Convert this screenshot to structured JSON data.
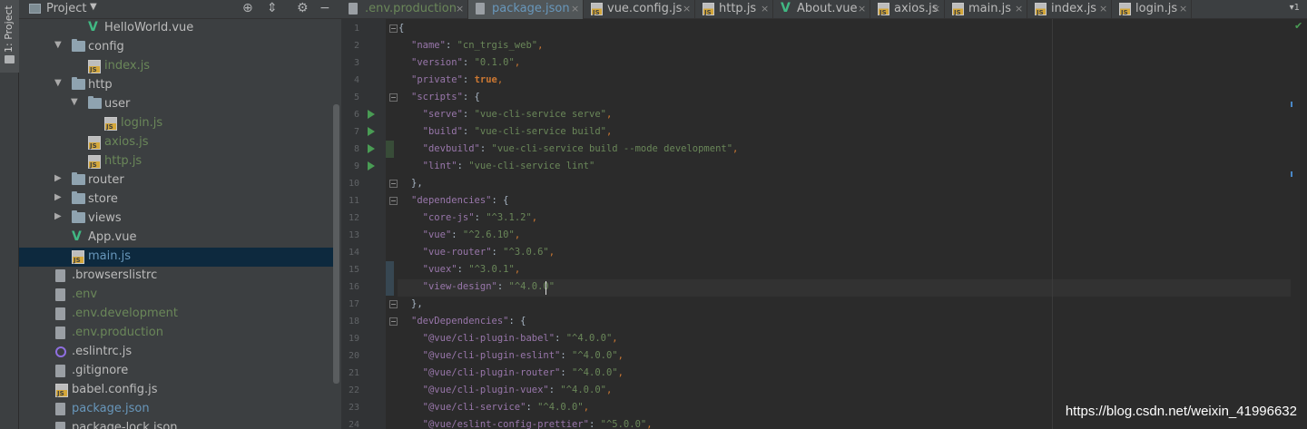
{
  "tool_window": {
    "label": "1: Project"
  },
  "project_panel": {
    "title": "Project",
    "tree": [
      {
        "label": "HelloWorld.vue",
        "icon": "vue-icon",
        "color": "#bbbbbb",
        "depth": 3
      },
      {
        "label": "config",
        "icon": "folder-icon",
        "color": "#bbbbbb",
        "depth": 2,
        "expanded": true
      },
      {
        "label": "index.js",
        "icon": "js-file-icon",
        "color": "#6a8759",
        "depth": 3
      },
      {
        "label": "http",
        "icon": "folder-icon",
        "color": "#bbbbbb",
        "depth": 2,
        "expanded": true
      },
      {
        "label": "user",
        "icon": "folder-icon",
        "color": "#bbbbbb",
        "depth": 3,
        "expanded": true
      },
      {
        "label": "login.js",
        "icon": "js-file-icon",
        "color": "#6a8759",
        "depth": 4
      },
      {
        "label": "axios.js",
        "icon": "js-file-icon",
        "color": "#6a8759",
        "depth": 3
      },
      {
        "label": "http.js",
        "icon": "js-file-icon",
        "color": "#6a8759",
        "depth": 3
      },
      {
        "label": "router",
        "icon": "folder-icon",
        "color": "#bbbbbb",
        "depth": 2,
        "expanded": false
      },
      {
        "label": "store",
        "icon": "folder-icon",
        "color": "#bbbbbb",
        "depth": 2,
        "expanded": false
      },
      {
        "label": "views",
        "icon": "folder-icon",
        "color": "#bbbbbb",
        "depth": 2,
        "expanded": false
      },
      {
        "label": "App.vue",
        "icon": "vue-icon",
        "color": "#bbbbbb",
        "depth": 2
      },
      {
        "label": "main.js",
        "icon": "js-file-icon",
        "color": "#6897bb",
        "depth": 2,
        "selected": true
      },
      {
        "label": ".browserslistrc",
        "icon": "text-file-icon",
        "color": "#bbbbbb",
        "depth": 1
      },
      {
        "label": ".env",
        "icon": "text-file-icon",
        "color": "#6a8759",
        "depth": 1
      },
      {
        "label": ".env.development",
        "icon": "text-file-icon",
        "color": "#6a8759",
        "depth": 1
      },
      {
        "label": ".env.production",
        "icon": "text-file-icon",
        "color": "#6a8759",
        "depth": 1
      },
      {
        "label": ".eslintrc.js",
        "icon": "eslint-icon",
        "color": "#bbbbbb",
        "depth": 1
      },
      {
        "label": ".gitignore",
        "icon": "text-file-icon",
        "color": "#bbbbbb",
        "depth": 1
      },
      {
        "label": "babel.config.js",
        "icon": "js-file-icon",
        "color": "#bbbbbb",
        "depth": 1
      },
      {
        "label": "package.json",
        "icon": "text-file-icon",
        "color": "#6897bb",
        "depth": 1
      },
      {
        "label": "package-lock.json",
        "icon": "text-file-icon",
        "color": "#bbbbbb",
        "depth": 1
      }
    ]
  },
  "tabs": [
    {
      "label": ".env.production",
      "icon": "text-file-icon",
      "color": "#6a8759"
    },
    {
      "label": "package.json",
      "icon": "text-file-icon",
      "color": "#6897bb",
      "active": true
    },
    {
      "label": "vue.config.js",
      "icon": "js-file-icon",
      "color": "#bbbbbb"
    },
    {
      "label": "http.js",
      "icon": "js-file-icon",
      "color": "#bbbbbb"
    },
    {
      "label": "About.vue",
      "icon": "vue-icon",
      "color": "#bbbbbb"
    },
    {
      "label": "axios.js",
      "icon": "js-file-icon",
      "color": "#bbbbbb"
    },
    {
      "label": "main.js",
      "icon": "js-file-icon",
      "color": "#bbbbbb"
    },
    {
      "label": "index.js",
      "icon": "js-file-icon",
      "color": "#bbbbbb"
    },
    {
      "label": "login.js",
      "icon": "js-file-icon",
      "color": "#bbbbbb"
    }
  ],
  "editor": {
    "lines": [
      {
        "n": "1",
        "tokens": [
          [
            "t",
            "{"
          ]
        ]
      },
      {
        "n": "2",
        "tokens": [
          [
            "k",
            "\"name\""
          ],
          [
            "t",
            ": "
          ],
          [
            "s",
            "\"cn_trgis_web\""
          ],
          [
            "p",
            ","
          ]
        ]
      },
      {
        "n": "3",
        "tokens": [
          [
            "k",
            "\"version\""
          ],
          [
            "t",
            ": "
          ],
          [
            "s",
            "\"0.1.0\""
          ],
          [
            "p",
            ","
          ]
        ]
      },
      {
        "n": "4",
        "tokens": [
          [
            "k",
            "\"private\""
          ],
          [
            "t",
            ": "
          ],
          [
            "b",
            "true"
          ],
          [
            "p",
            ","
          ]
        ]
      },
      {
        "n": "5",
        "tokens": [
          [
            "k",
            "\"scripts\""
          ],
          [
            "t",
            ": {"
          ]
        ]
      },
      {
        "n": "6",
        "tokens": [
          [
            "t",
            "  "
          ],
          [
            "k",
            "\"serve\""
          ],
          [
            "t",
            ": "
          ],
          [
            "s",
            "\"vue-cli-service serve\""
          ],
          [
            "p",
            ","
          ]
        ]
      },
      {
        "n": "7",
        "tokens": [
          [
            "t",
            "  "
          ],
          [
            "k",
            "\"build\""
          ],
          [
            "t",
            ": "
          ],
          [
            "s",
            "\"vue-cli-service build\""
          ],
          [
            "p",
            ","
          ]
        ]
      },
      {
        "n": "8",
        "tokens": [
          [
            "t",
            "  "
          ],
          [
            "k",
            "\"devbuild\""
          ],
          [
            "t",
            ": "
          ],
          [
            "s",
            "\"vue-cli-service build --mode development\""
          ],
          [
            "p",
            ","
          ]
        ]
      },
      {
        "n": "9",
        "tokens": [
          [
            "t",
            "  "
          ],
          [
            "k",
            "\"lint\""
          ],
          [
            "t",
            ": "
          ],
          [
            "s",
            "\"vue-cli-service lint\""
          ]
        ]
      },
      {
        "n": "10",
        "tokens": [
          [
            "t",
            "},"
          ]
        ]
      },
      {
        "n": "11",
        "tokens": [
          [
            "k",
            "\"dependencies\""
          ],
          [
            "t",
            ": {"
          ]
        ]
      },
      {
        "n": "12",
        "tokens": [
          [
            "t",
            "  "
          ],
          [
            "k",
            "\"core-js\""
          ],
          [
            "t",
            ": "
          ],
          [
            "s",
            "\"^3.1.2\""
          ],
          [
            "p",
            ","
          ]
        ]
      },
      {
        "n": "13",
        "tokens": [
          [
            "t",
            "  "
          ],
          [
            "k",
            "\"vue\""
          ],
          [
            "t",
            ": "
          ],
          [
            "s",
            "\"^2.6.10\""
          ],
          [
            "p",
            ","
          ]
        ]
      },
      {
        "n": "14",
        "tokens": [
          [
            "t",
            "  "
          ],
          [
            "k",
            "\"vue-router\""
          ],
          [
            "t",
            ": "
          ],
          [
            "s",
            "\"^3.0.6\""
          ],
          [
            "p",
            ","
          ]
        ]
      },
      {
        "n": "15",
        "tokens": [
          [
            "t",
            "  "
          ],
          [
            "k",
            "\"vuex\""
          ],
          [
            "t",
            ": "
          ],
          [
            "s",
            "\"^3.0.1\""
          ],
          [
            "p",
            ","
          ]
        ]
      },
      {
        "n": "16",
        "tokens": [
          [
            "t",
            "  "
          ],
          [
            "k",
            "\"view-design\""
          ],
          [
            "t",
            ": "
          ],
          [
            "s",
            "\"^4.0.0\""
          ]
        ]
      },
      {
        "n": "17",
        "tokens": [
          [
            "t",
            "},"
          ]
        ]
      },
      {
        "n": "18",
        "tokens": [
          [
            "k",
            "\"devDependencies\""
          ],
          [
            "t",
            ": {"
          ]
        ]
      },
      {
        "n": "19",
        "tokens": [
          [
            "t",
            "  "
          ],
          [
            "k",
            "\"@vue/cli-plugin-babel\""
          ],
          [
            "t",
            ": "
          ],
          [
            "s",
            "\"^4.0.0\""
          ],
          [
            "p",
            ","
          ]
        ]
      },
      {
        "n": "20",
        "tokens": [
          [
            "t",
            "  "
          ],
          [
            "k",
            "\"@vue/cli-plugin-eslint\""
          ],
          [
            "t",
            ": "
          ],
          [
            "s",
            "\"^4.0.0\""
          ],
          [
            "p",
            ","
          ]
        ]
      },
      {
        "n": "21",
        "tokens": [
          [
            "t",
            "  "
          ],
          [
            "k",
            "\"@vue/cli-plugin-router\""
          ],
          [
            "t",
            ": "
          ],
          [
            "s",
            "\"^4.0.0\""
          ],
          [
            "p",
            ","
          ]
        ]
      },
      {
        "n": "22",
        "tokens": [
          [
            "t",
            "  "
          ],
          [
            "k",
            "\"@vue/cli-plugin-vuex\""
          ],
          [
            "t",
            ": "
          ],
          [
            "s",
            "\"^4.0.0\""
          ],
          [
            "p",
            ","
          ]
        ]
      },
      {
        "n": "23",
        "tokens": [
          [
            "t",
            "  "
          ],
          [
            "k",
            "\"@vue/cli-service\""
          ],
          [
            "t",
            ": "
          ],
          [
            "s",
            "\"^4.0.0\""
          ],
          [
            "p",
            ","
          ]
        ]
      },
      {
        "n": "24",
        "tokens": [
          [
            "t",
            "  "
          ],
          [
            "k",
            "\"@vue/eslint-config-prettier\""
          ],
          [
            "t",
            ": "
          ],
          [
            "s",
            "\"^5.0.0\""
          ],
          [
            "p",
            ","
          ]
        ]
      }
    ]
  },
  "watermark": "https://blog.csdn.net/weixin_41996632"
}
